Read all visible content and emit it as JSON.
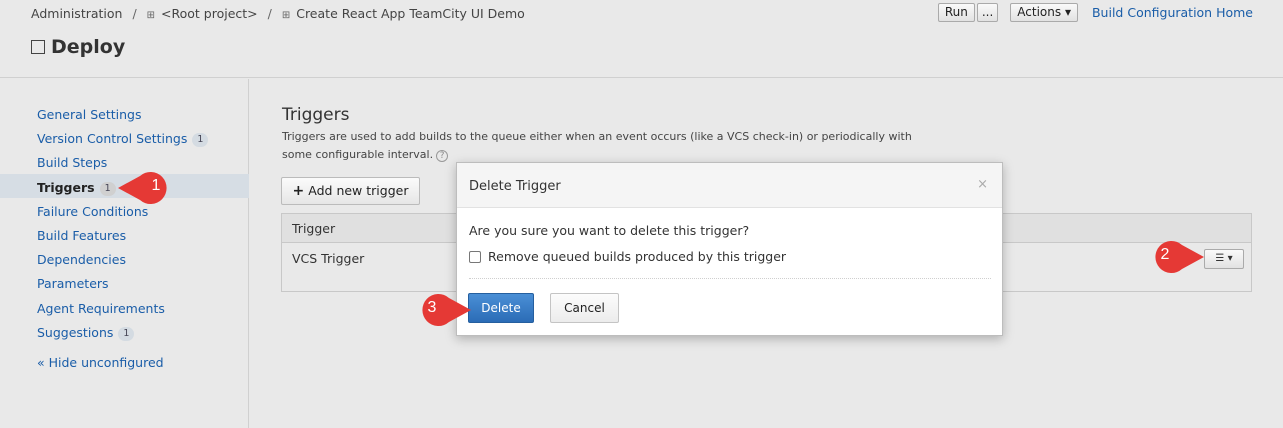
{
  "header": {
    "breadcrumb": [
      "Administration",
      "<Root project>",
      "Create React App TeamCity UI Demo"
    ],
    "breadcrumb_sep": "/",
    "title": "Deploy",
    "run_label": "Run",
    "more_label": "...",
    "actions_label": "Actions",
    "home_link": "Build Configuration Home"
  },
  "sidebar": {
    "items": [
      {
        "label": "General Settings",
        "count": ""
      },
      {
        "label": "Version Control Settings",
        "count": "1"
      },
      {
        "label": "Build Steps",
        "count": ""
      },
      {
        "label": "Triggers",
        "count": "1",
        "active": true
      },
      {
        "label": "Failure Conditions",
        "count": ""
      },
      {
        "label": "Build Features",
        "count": ""
      },
      {
        "label": "Dependencies",
        "count": ""
      },
      {
        "label": "Parameters",
        "count": ""
      },
      {
        "label": "Agent Requirements",
        "count": ""
      },
      {
        "label": "Suggestions",
        "count": "1"
      }
    ],
    "hide_unconfigured": "« Hide unconfigured"
  },
  "main": {
    "title": "Triggers",
    "description": "Triggers are used to add builds to the queue either when an event occurs (like a VCS check-in) or periodically with some configurable interval.",
    "add_button": "Add new trigger",
    "table": {
      "header": "Trigger",
      "rows": [
        {
          "trigger": "VCS Trigger"
        }
      ]
    }
  },
  "dialog": {
    "title": "Delete Trigger",
    "question": "Are you sure you want to delete this trigger?",
    "checkbox_label": "Remove queued builds produced by this trigger",
    "checkbox_checked": false,
    "delete_label": "Delete",
    "cancel_label": "Cancel",
    "close_symbol": "×"
  },
  "callouts": [
    "1",
    "2",
    "3"
  ],
  "colors": {
    "link": "#1a5da8",
    "primary_button": "#2b6cb6",
    "callout": "#e53935"
  }
}
